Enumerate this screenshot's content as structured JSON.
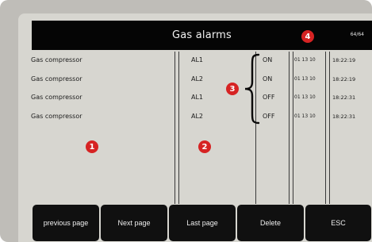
{
  "header": {
    "title": "Gas alarms",
    "page_indicator": "64/64"
  },
  "alarms": [
    {
      "description": "Gas compressor",
      "code": "AL1",
      "state": "ON",
      "date": "01 13 10",
      "time": "18:22:19"
    },
    {
      "description": "Gas compressor",
      "code": "AL2",
      "state": "ON",
      "date": "01 13 10",
      "time": "18:22:19"
    },
    {
      "description": "Gas compressor",
      "code": "AL1",
      "state": "OFF",
      "date": "01 13 10",
      "time": "18:22:31"
    },
    {
      "description": "Gas compressor",
      "code": "AL2",
      "state": "OFF",
      "date": "01 13 10",
      "time": "18:22:31"
    }
  ],
  "markers": [
    "1",
    "2",
    "3",
    "4"
  ],
  "buttons": {
    "previous_page": "previous page",
    "next_page": "Next page",
    "last_page": "Last page",
    "delete": "Delete",
    "esc": "ESC"
  },
  "colors": {
    "title_bar": "#050505",
    "screen_bg": "#d7d6d0",
    "marker": "#d62323",
    "button_bg": "#101010"
  }
}
